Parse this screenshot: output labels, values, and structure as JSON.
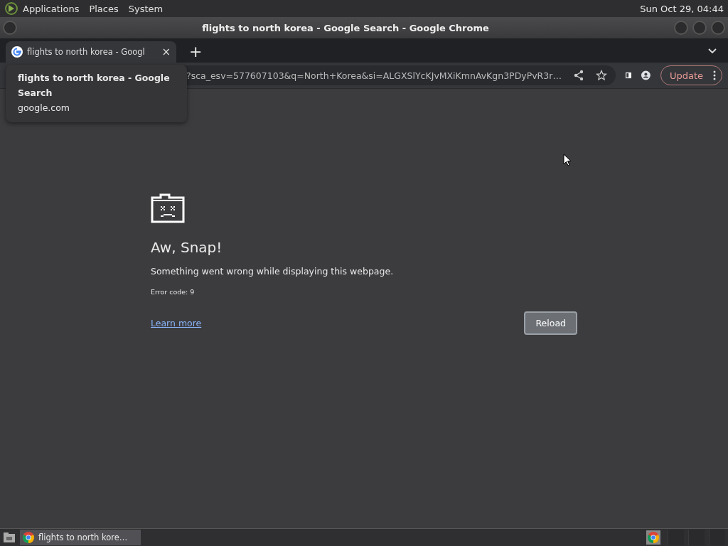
{
  "top_panel": {
    "menus": [
      "Applications",
      "Places",
      "System"
    ],
    "clock": "Sun Oct 29, 04:44"
  },
  "window": {
    "title": "flights to north korea - Google Search - Google Chrome"
  },
  "tabs": [
    {
      "label": "flights to north korea - Googl",
      "selected": true,
      "close": "×"
    }
  ],
  "new_tab": "+",
  "tooltip": {
    "title": "flights to north korea - Google Search",
    "domain": "google.com"
  },
  "address_bar": {
    "value": "?sca_esv=577607103&q=North+Korea&si=ALGXSlYcKJvMXiKmnAvKgn3PDyPvR3r…"
  },
  "update_button": "Update",
  "error": {
    "title": "Aw, Snap!",
    "message": "Something went wrong while displaying this webpage.",
    "code": "Error code: 9",
    "link": "Learn more",
    "button": "Reload"
  },
  "taskbar": {
    "items": [
      {
        "label": "flights to north kore…",
        "selected": true
      }
    ]
  }
}
